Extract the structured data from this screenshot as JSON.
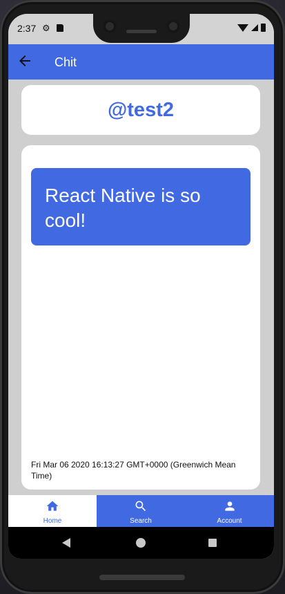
{
  "status_bar": {
    "time": "2:37"
  },
  "header": {
    "title": "Chit",
    "back_icon": "arrow-left-icon"
  },
  "profile": {
    "username": "@test2"
  },
  "chit": {
    "message": "React Native is so cool!",
    "timestamp": "Fri Mar 06 2020 16:13:27 GMT+0000 (Greenwich Mean Time)"
  },
  "bottom_nav": {
    "items": [
      {
        "label": "Home",
        "icon": "home-icon",
        "active": true
      },
      {
        "label": "Search",
        "icon": "search-icon",
        "active": false
      },
      {
        "label": "Account",
        "icon": "account-icon",
        "active": false
      }
    ]
  },
  "colors": {
    "accent": "#4169e1",
    "background": "#cfcfcf",
    "card": "#ffffff"
  }
}
